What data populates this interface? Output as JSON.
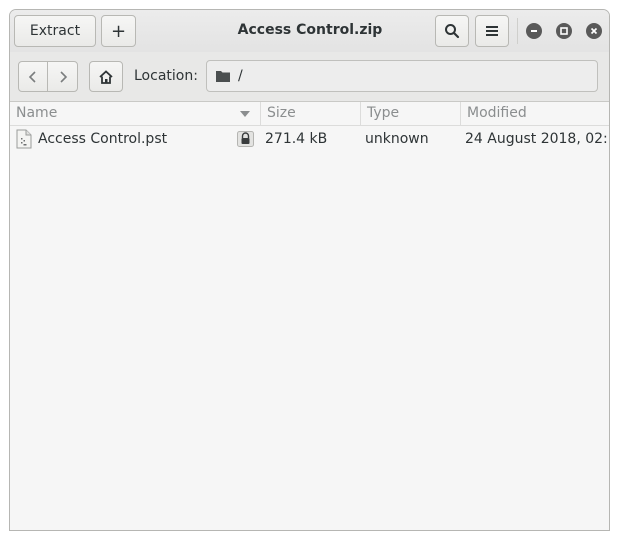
{
  "header": {
    "title": "Access Control.zip",
    "extract_label": "Extract",
    "add_label": "+"
  },
  "toolbar": {
    "location_label": "Location:",
    "location_value": "/"
  },
  "columns": [
    "Name",
    "Size",
    "Type",
    "Modified"
  ],
  "files": [
    {
      "name": "Access Control.pst",
      "size": "271.4 kB",
      "type": "unknown",
      "modified": "24 August 2018, 02:..."
    }
  ]
}
